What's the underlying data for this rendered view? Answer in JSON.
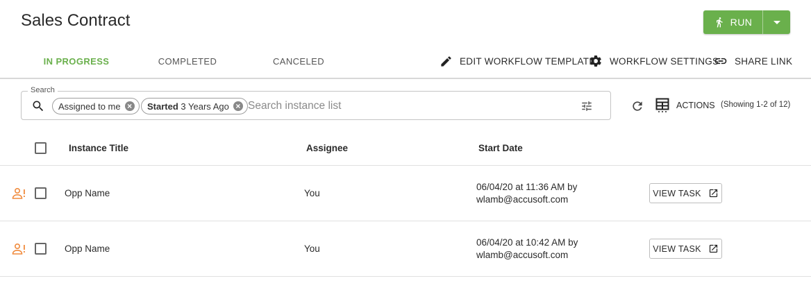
{
  "page": {
    "title": "Sales Contract"
  },
  "run": {
    "label": "RUN"
  },
  "tabs": [
    {
      "label": "IN PROGRESS",
      "active": true
    },
    {
      "label": "COMPLETED",
      "active": false
    },
    {
      "label": "CANCELED",
      "active": false
    }
  ],
  "top_actions": {
    "edit_template": "EDIT WORKFLOW TEMPLATE",
    "settings": "WORKFLOW SETTINGS",
    "share": "SHARE LINK"
  },
  "search": {
    "legend": "Search",
    "placeholder": "Search instance list",
    "value": "",
    "chips": [
      {
        "bold": "",
        "text": "Assigned to me"
      },
      {
        "bold": "Started",
        "text": "3 Years Ago"
      }
    ]
  },
  "toolbar": {
    "actions_label": "ACTIONS",
    "showing": "(Showing 1-2 of 12)"
  },
  "table": {
    "columns": [
      "Instance Title",
      "Assignee",
      "Start Date"
    ],
    "rows": [
      {
        "title": "Opp Name",
        "assignee": "You",
        "date_line1": "06/04/20 at 11:36 AM by",
        "date_line2": "wlamb@accusoft.com",
        "action": "VIEW TASK"
      },
      {
        "title": "Opp Name",
        "assignee": "You",
        "date_line1": "06/04/20 at 10:42 AM by",
        "date_line2": "wlamb@accusoft.com",
        "action": "VIEW TASK"
      }
    ]
  },
  "colors": {
    "accent": "#6ab04c",
    "assign_icon": "#f08a3c"
  }
}
